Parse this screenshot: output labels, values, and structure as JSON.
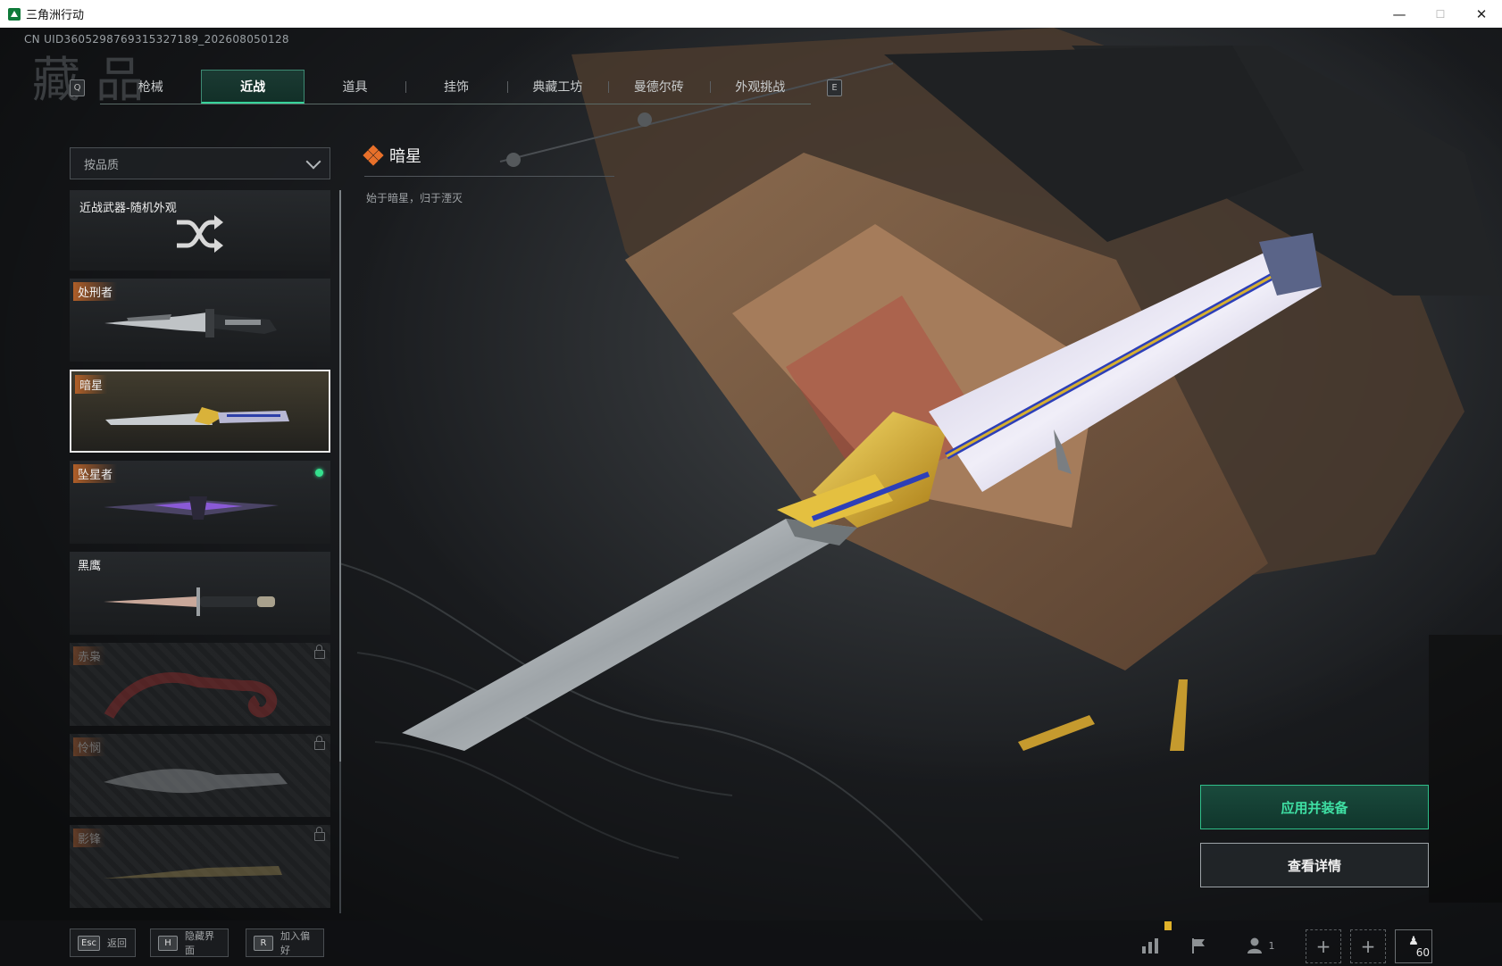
{
  "window": {
    "title": "三角洲行动",
    "controls": [
      "—",
      "☐",
      "✕"
    ]
  },
  "uid": "CN UID3605298769315327189_202608050128",
  "watermark": "藏 品",
  "tabs": {
    "prev_key": "Q",
    "next_key": "E",
    "items": [
      {
        "label": "枪械",
        "active": false
      },
      {
        "label": "近战",
        "active": true
      },
      {
        "label": "道具",
        "active": false
      },
      {
        "label": "挂饰",
        "active": false
      },
      {
        "label": "典藏工坊",
        "active": false
      },
      {
        "label": "曼德尔砖",
        "active": false
      },
      {
        "label": "外观挑战",
        "active": false
      }
    ]
  },
  "filter": {
    "label": "按品质"
  },
  "list": {
    "random": {
      "label": "近战武器-随机外观",
      "icon": "shuffle-icon"
    },
    "items": [
      {
        "label": "处刑者",
        "state": "owned"
      },
      {
        "label": "暗星",
        "state": "selected"
      },
      {
        "label": "坠星者",
        "state": "equipped"
      },
      {
        "label": "黑鹰",
        "state": "owned"
      },
      {
        "label": "赤枭",
        "state": "locked"
      },
      {
        "label": "怜悯",
        "state": "locked"
      },
      {
        "label": "影锋",
        "state": "locked"
      }
    ]
  },
  "detail": {
    "name": "暗星",
    "description": "始于暗星，归于湮灭",
    "rarity_color": "#e8702a"
  },
  "actions": {
    "apply": "应用并装备",
    "details": "查看详情"
  },
  "hints": [
    {
      "key": "Esc",
      "label": "返回"
    },
    {
      "key": "H",
      "label": "隐藏界面"
    },
    {
      "key": "R",
      "label": "加入偏好"
    }
  ],
  "system": {
    "friends_count": "1",
    "level": "60"
  },
  "colors": {
    "accent": "#37d39a",
    "bg": "#1b1e22"
  }
}
